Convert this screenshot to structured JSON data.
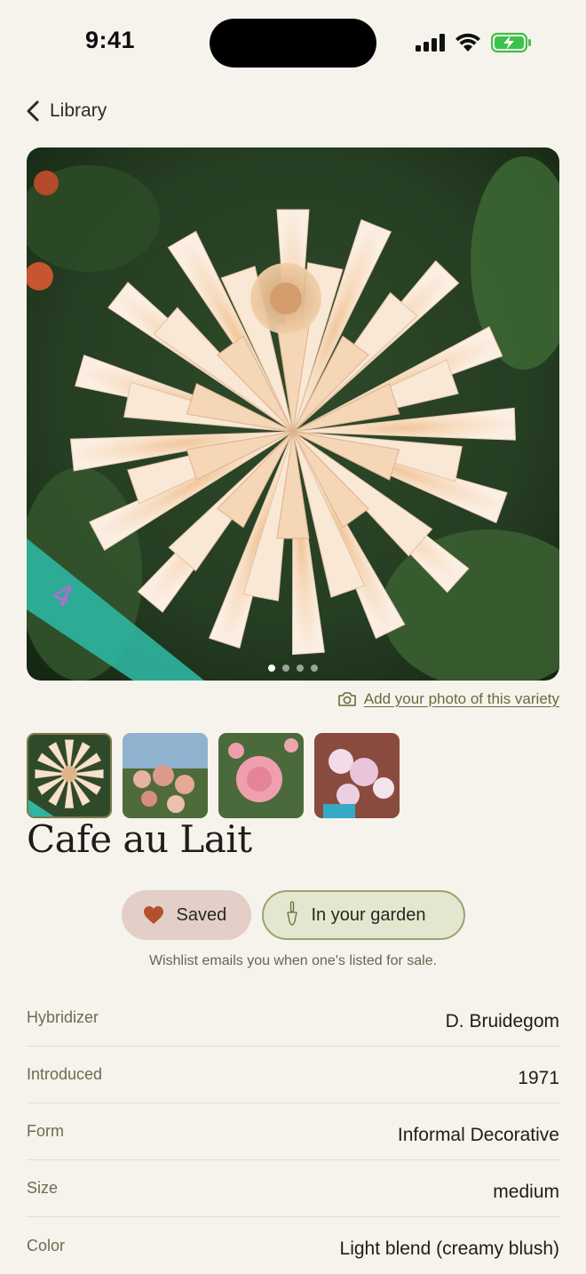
{
  "status_bar": {
    "time": "9:41"
  },
  "nav": {
    "back_label": "Library"
  },
  "gallery": {
    "photo_count": 4,
    "active_index": 0
  },
  "add_photo": {
    "label": "Add your photo of this variety"
  },
  "variety": {
    "name": "Cafe au Lait"
  },
  "actions": {
    "saved_label": "Saved",
    "garden_label": "In your garden",
    "note": "Wishlist emails you when one's listed for sale."
  },
  "details": [
    {
      "label": "Hybridizer",
      "value": "D. Bruidegom"
    },
    {
      "label": "Introduced",
      "value": "1971"
    },
    {
      "label": "Form",
      "value": "Informal Decorative"
    },
    {
      "label": "Size",
      "value": "medium"
    },
    {
      "label": "Color",
      "value": "Light blend (creamy blush)"
    }
  ],
  "colors": {
    "background": "#f6f3ed",
    "accent_olive": "#7a7a4a",
    "saved_bg": "#e3cfc7",
    "heart": "#b4502f",
    "garden_bg": "#e4e7cf"
  },
  "icons": {
    "back": "chevron-left-icon",
    "camera": "camera-icon",
    "heart": "heart-icon",
    "trowel": "trowel-icon"
  }
}
